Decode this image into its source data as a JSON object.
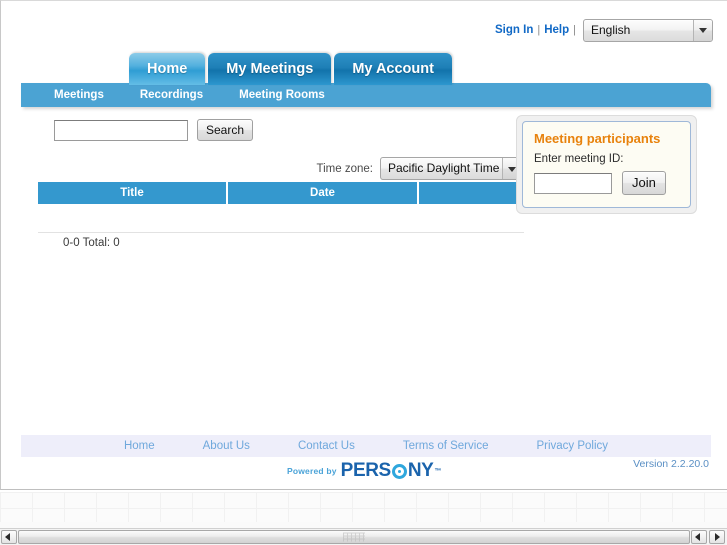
{
  "utility": {
    "sign_in": "Sign In",
    "help": "Help",
    "separator": "|",
    "language": "English"
  },
  "tabs": [
    {
      "label": "Home",
      "active": true
    },
    {
      "label": "My Meetings",
      "active": false
    },
    {
      "label": "My Account",
      "active": false
    }
  ],
  "subnav": [
    {
      "label": "Meetings"
    },
    {
      "label": "Recordings"
    },
    {
      "label": "Meeting Rooms"
    }
  ],
  "search": {
    "value": "",
    "placeholder": "",
    "button_label": "Search"
  },
  "timezone": {
    "label": "Time zone:",
    "value": "Pacific Daylight Time"
  },
  "table": {
    "columns": [
      "Title",
      "Date",
      ""
    ],
    "rows": [],
    "result_count": "0-0 Total: 0"
  },
  "participants": {
    "title": "Meeting participants",
    "label": "Enter meeting ID:",
    "input_value": "",
    "join_label": "Join"
  },
  "footer": {
    "links": [
      "Home",
      "About Us",
      "Contact Us",
      "Terms of Service",
      "Privacy Policy"
    ],
    "powered_by": "Powered by",
    "brand_part1": "PERS",
    "brand_part2": "NY",
    "brand_tm": "™",
    "version": "Version 2.2.20.0"
  },
  "colors": {
    "tab_blue": "#1e7fb6",
    "subnav_blue": "#4ba3d3",
    "table_header_blue": "#3498ce",
    "panel_orange": "#e8820c",
    "link_blue": "#1169c6",
    "footer_link_blue": "#6fa8dc"
  }
}
